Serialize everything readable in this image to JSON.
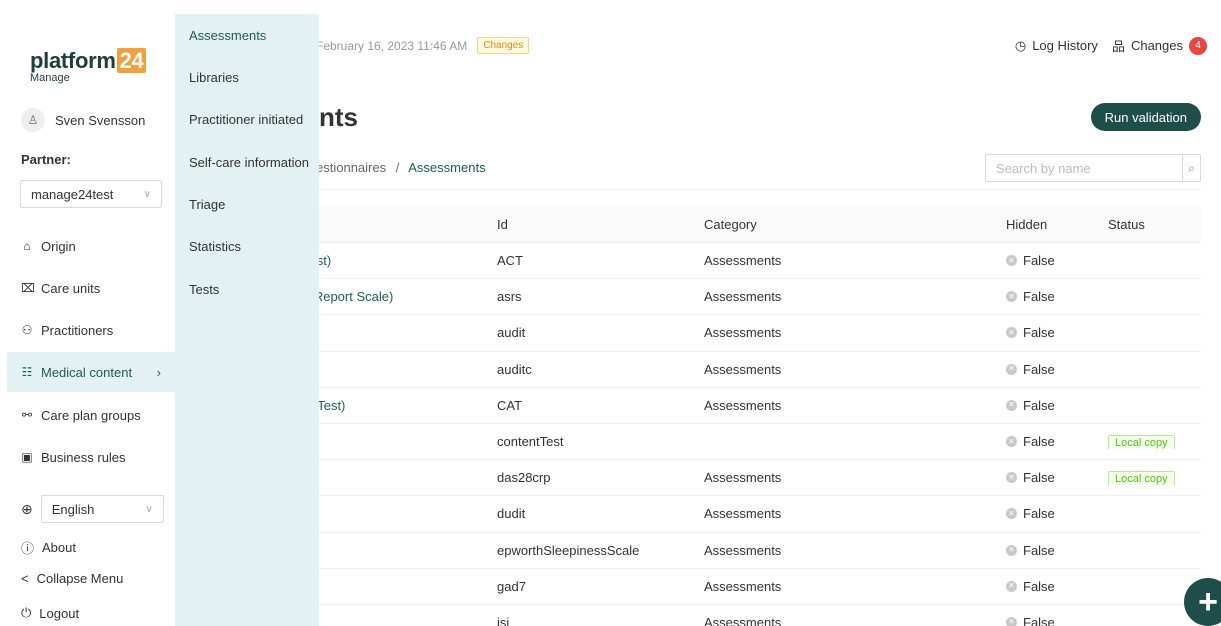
{
  "brand": {
    "name": "platform",
    "num": "24",
    "sub": "Manage"
  },
  "user": {
    "name": "Sven Svensson"
  },
  "partner": {
    "label": "Partner:",
    "value": "manage24test"
  },
  "nav": [
    {
      "label": "Origin",
      "icon": "⌂"
    },
    {
      "label": "Care units",
      "icon": "⌧"
    },
    {
      "label": "Practitioners",
      "icon": "⚇"
    },
    {
      "label": "Medical content",
      "icon": "☷"
    },
    {
      "label": "Care plan groups",
      "icon": "⚯"
    },
    {
      "label": "Business rules",
      "icon": "▣"
    }
  ],
  "nav_arrow": "›",
  "language": {
    "value": "English"
  },
  "bottom_links": [
    {
      "label": "About",
      "icon": "ⓘ"
    },
    {
      "label": "Collapse Menu",
      "icon": "<"
    },
    {
      "label": "Logout",
      "icon": "⏻"
    }
  ],
  "submenu": [
    "Assessments",
    "Libraries",
    "Practitioner initiated",
    "Self-care information",
    "Triage",
    "Statistics",
    "Tests"
  ],
  "topbar": {
    "date": "February 16, 2023 11:46 AM",
    "changes_tag": "Changes",
    "log_history": "Log History",
    "changes": "Changes",
    "changes_count": "4"
  },
  "page": {
    "title": "nts",
    "run_validation": "Run validation",
    "breadcrumb_prev": "estionnaires",
    "breadcrumb_sep": "/",
    "breadcrumb_current": "Assessments",
    "search_placeholder": "Search by name"
  },
  "table": {
    "columns": [
      "Id",
      "Category",
      "Hidden",
      "Status"
    ],
    "rows": [
      {
        "name": "Test)",
        "id": "ACT",
        "category": "Assessments",
        "hidden": "False",
        "status": ""
      },
      {
        "name": "lf-Report Scale)",
        "id": "asrs",
        "category": "Assessments",
        "hidden": "False",
        "status": ""
      },
      {
        "name": "",
        "id": "audit",
        "category": "Assessments",
        "hidden": "False",
        "status": ""
      },
      {
        "name": "",
        "id": "auditc",
        "category": "Assessments",
        "hidden": "False",
        "status": ""
      },
      {
        "name": "nt Test)",
        "id": "CAT",
        "category": "Assessments",
        "hidden": "False",
        "status": ""
      },
      {
        "name": "",
        "id": "contentTest",
        "category": "",
        "hidden": "False",
        "status": "Local copy"
      },
      {
        "name": "",
        "id": "das28crp",
        "category": "Assessments",
        "hidden": "False",
        "status": "Local copy"
      },
      {
        "name": "",
        "id": "dudit",
        "category": "Assessments",
        "hidden": "False",
        "status": ""
      },
      {
        "name": "",
        "id": "epworthSleepinessScale",
        "category": "Assessments",
        "hidden": "False",
        "status": ""
      },
      {
        "name": "",
        "id": "gad7",
        "category": "Assessments",
        "hidden": "False",
        "status": ""
      },
      {
        "name": "",
        "id": "isi",
        "category": "Assessments",
        "hidden": "False",
        "status": ""
      }
    ]
  },
  "fab": "+"
}
